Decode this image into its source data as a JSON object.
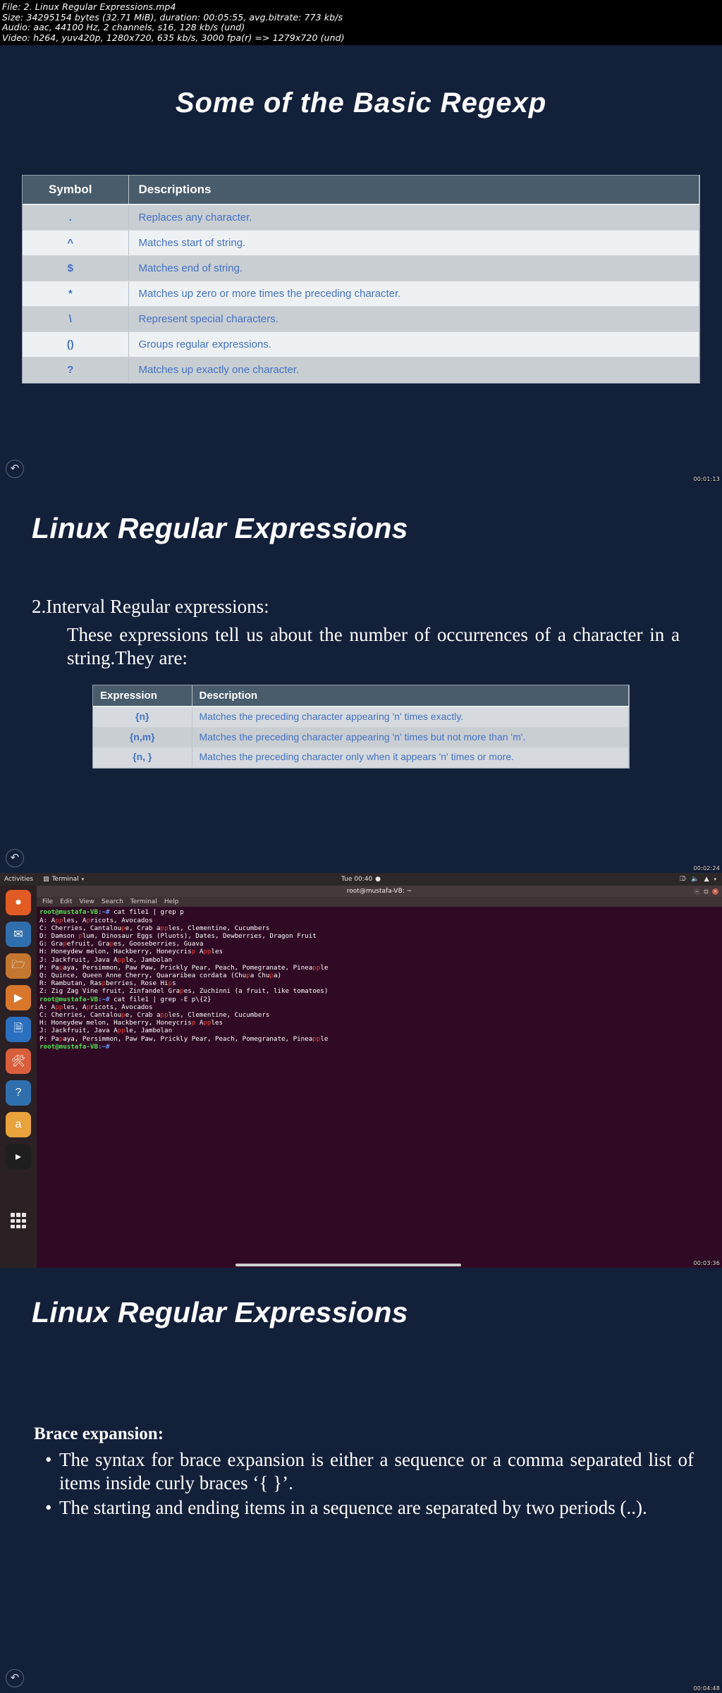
{
  "fileinfo": {
    "line1": "File: 2. Linux Regular Expressions.mp4",
    "line2": "Size: 34295154 bytes (32.71 MiB), duration: 00:05:55, avg.bitrate: 773 kb/s",
    "line3": "Audio: aac, 44100 Hz, 2 channels, s16, 128 kb/s (und)",
    "line4": "Video: h264, yuv420p, 1280x720, 635 kb/s, 3000 fpa(r) => 1279x720 (und)"
  },
  "frames": [
    {
      "timestamp": "00:01:13",
      "title": "Some of the Basic Regexp",
      "table": {
        "headers": [
          "Symbol",
          "Descriptions"
        ],
        "rows": [
          [
            ".",
            "Replaces any character."
          ],
          [
            "^",
            "Matches start of string."
          ],
          [
            "$",
            "Matches end of string."
          ],
          [
            "*",
            "Matches up zero or more times the preceding character."
          ],
          [
            "\\",
            "Represent special characters."
          ],
          [
            "()",
            "Groups regular expressions."
          ],
          [
            "?",
            "Matches up exactly one character."
          ]
        ]
      },
      "back_icon": "back-arrow-icon"
    },
    {
      "timestamp": "00:02:24",
      "title": "Linux Regular Expressions",
      "heading": "2.Interval Regular expressions:",
      "paragraph": "These expressions tell us about the number of occurrences of a character in a string.They are:",
      "table": {
        "headers": [
          "Expression",
          "Description"
        ],
        "rows": [
          [
            "{n}",
            "Matches the preceding character appearing 'n' times exactly."
          ],
          [
            "{n,m}",
            "Matches the preceding character appearing 'n' times but not more than 'm'."
          ],
          [
            "{n, }",
            "Matches the preceding character only when it appears 'n' times or more."
          ]
        ]
      },
      "back_icon": "back-arrow-icon"
    },
    {
      "timestamp": "00:03:36",
      "desktop": {
        "topbar": {
          "activities": "Activities",
          "app_icon": "terminal-app-icon",
          "app_name": "Terminal",
          "caret": "▾",
          "clock": "Tue 00:40",
          "clock_dot": "●",
          "sys_icons": [
            "keyboard-layout-icon",
            "volume-icon",
            "network-icon",
            "power-menu-icon"
          ],
          "sys_glyphs": [
            "⌨",
            "🔊",
            "▾"
          ]
        },
        "dock": [
          {
            "name": "firefox-icon",
            "glyph": "🦊",
            "color": "#e25b24"
          },
          {
            "name": "thunderbird-icon",
            "glyph": "✉",
            "color": "#3a6ea5"
          },
          {
            "name": "files-icon",
            "glyph": "🗀",
            "color": "#c4772f"
          },
          {
            "name": "rhythmbox-icon",
            "glyph": "▶",
            "color": "#d8762b"
          },
          {
            "name": "libreoffice-writer-icon",
            "glyph": "🗎",
            "color": "#2b6fbf"
          },
          {
            "name": "ubuntu-software-icon",
            "glyph": "🛎",
            "color": "#d95f3c"
          },
          {
            "name": "help-icon",
            "glyph": "?",
            "color": "#2f6fae"
          },
          {
            "name": "amazon-icon",
            "glyph": "a",
            "color": "#e8a33d"
          },
          {
            "name": "terminal-icon",
            "glyph": "▸",
            "color": "#1e1e1e"
          }
        ],
        "dock_apps_grid": "show-applications-icon",
        "window": {
          "title": "root@mustafa-VB: ~",
          "menus": [
            "File",
            "Edit",
            "View",
            "Search",
            "Terminal",
            "Help"
          ],
          "buttons": [
            "minimize",
            "maximize",
            "close"
          ],
          "lines": [
            {
              "type": "prompt",
              "user": "root@mustafa-VB",
              "path": ":~# ",
              "cmd": "cat file1 | grep p"
            },
            {
              "type": "out",
              "text": "A: Apples, Apricots, Avocados"
            },
            {
              "type": "out",
              "text": "C: Cherries, Cantaloupe, Crab apples, Clementine, Cucumbers"
            },
            {
              "type": "out",
              "text": "D: Damson plum, Dinosaur Eggs (Pluots), Dates, Dewberries, Dragon Fruit"
            },
            {
              "type": "out",
              "text": "G: Grapefruit, Grapes, Gooseberries, Guava"
            },
            {
              "type": "out",
              "text": "H: Honeydew melon, Hackberry, Honeycrisp Apples"
            },
            {
              "type": "out",
              "text": "J: Jackfruit, Java Apple, Jambolan"
            },
            {
              "type": "out",
              "text": "P: Papaya, Persimmon, Paw Paw, Prickly Pear, Peach, Pomegranate, Pineapple"
            },
            {
              "type": "out",
              "text": "Q: Quince, Queen Anne Cherry, Quararibea cordata (Chupa Chupa)"
            },
            {
              "type": "out",
              "text": "R: Rambutan, Raspberries, Rose Hips"
            },
            {
              "type": "out",
              "text": "Z: Zig Zag Vine fruit, Zinfandel Grapes, Zuchinni (a fruit, like tomatoes)"
            },
            {
              "type": "prompt",
              "user": "root@mustafa-VB",
              "path": ":~# ",
              "cmd": "cat file1 | grep -E p\\{2}"
            },
            {
              "type": "out",
              "text": "A: Apples, Apricots, Avocados"
            },
            {
              "type": "out",
              "text": "C: Cherries, Cantaloupe, Crab apples, Clementine, Cucumbers"
            },
            {
              "type": "out",
              "text": "H: Honeydew melon, Hackberry, Honeycrisp Apples"
            },
            {
              "type": "out",
              "text": "J: Jackfruit, Java Apple, Jambolan"
            },
            {
              "type": "out",
              "text": "P: Papaya, Persimmon, Paw Paw, Prickly Pear, Peach, Pomegranate, Pineapple"
            },
            {
              "type": "prompt",
              "user": "root@mustafa-VB",
              "path": ":~# ",
              "cmd": ""
            }
          ]
        }
      }
    },
    {
      "timestamp": "00:04:48",
      "title": "Linux Regular Expressions",
      "subheading": "Brace expansion:",
      "bullets": [
        "The syntax for brace expansion is either a sequence or a comma separated list of items inside curly braces ‘{ }’.",
        "The starting and ending items in a sequence are separated by two periods (..)."
      ],
      "back_icon": "back-arrow-icon"
    }
  ],
  "colors": {
    "slide_bg": "#13203a",
    "table_header_bg": "#495c6b",
    "table_text": "#4472c4",
    "terminal_bg": "#300a24",
    "grep_highlight": "#e9403a"
  }
}
